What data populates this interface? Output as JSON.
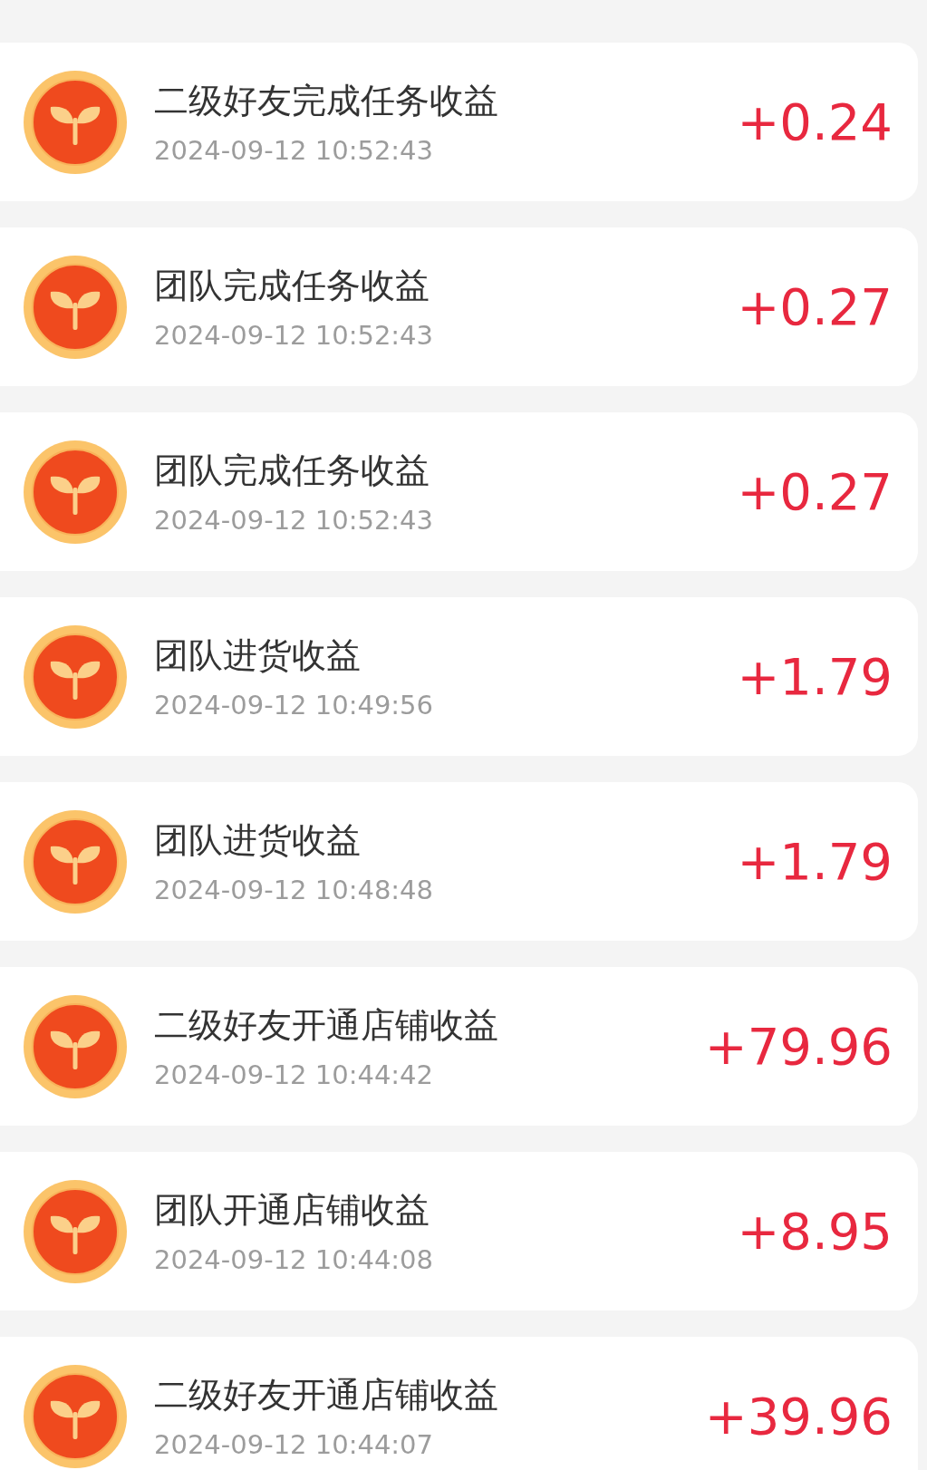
{
  "records": [
    {
      "title": "二级好友完成任务收益",
      "time": "2024-09-12 10:52:43",
      "amount": "+0.24"
    },
    {
      "title": "团队完成任务收益",
      "time": "2024-09-12 10:52:43",
      "amount": "+0.27"
    },
    {
      "title": "团队完成任务收益",
      "time": "2024-09-12 10:52:43",
      "amount": "+0.27"
    },
    {
      "title": "团队进货收益",
      "time": "2024-09-12 10:49:56",
      "amount": "+1.79"
    },
    {
      "title": "团队进货收益",
      "time": "2024-09-12 10:48:48",
      "amount": "+1.79"
    },
    {
      "title": "二级好友开通店铺收益",
      "time": "2024-09-12 10:44:42",
      "amount": "+79.96"
    },
    {
      "title": "团队开通店铺收益",
      "time": "2024-09-12 10:44:08",
      "amount": "+8.95"
    },
    {
      "title": "二级好友开通店铺收益",
      "time": "2024-09-12 10:44:07",
      "amount": "+39.96"
    }
  ]
}
